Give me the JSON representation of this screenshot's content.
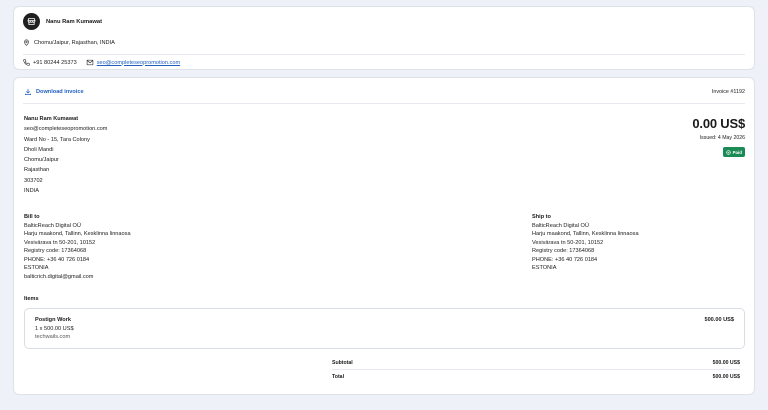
{
  "seller": {
    "name": "Nanu Ram Kumawat",
    "address": "Chomu/Jaipur, Rajasthan, INDIA",
    "phone": "+91 80244 25373",
    "email": "seo@completeseopromotion.com"
  },
  "invoice": {
    "download_label": "Download invoice",
    "number": "Invoice #1192",
    "amount": "0.00 US$",
    "issued": "Issued: 4 May 2026",
    "status": "Paid"
  },
  "from": {
    "name": "Nanu Ram Kumawat",
    "email": "seo@completeseopromotion.com",
    "lines": [
      "Ward No - 15, Tara Colony",
      "Dholi Mandi",
      "Chomu/Jaipur",
      "Rajasthan",
      "303702",
      "INDIA"
    ]
  },
  "bill_to": {
    "title": "Bill to",
    "lines": [
      "BalticReach Digital OÜ",
      "Harju maakond, Tallinn, Kesklinna linnaosa",
      "Vesivärava tn 50-201, 10152",
      "Registry code: 17364068",
      "PHONE: +36 40 726 0184",
      "ESTONIA",
      "balticrich.digital@gmail.com"
    ]
  },
  "ship_to": {
    "title": "Ship to",
    "lines": [
      "BalticReach Digital OÜ",
      "Harju maakond, Tallinn, Kesklinna linnaosa",
      "Vesivärava tn 50-201, 10152",
      "Registry code: 17364068",
      "PHONE: +36 40 726 0184",
      "ESTONIA"
    ]
  },
  "items": {
    "title": "Items",
    "list": [
      {
        "name": "Postign Work",
        "qty": "1 x 500.00 US$",
        "source": "techwails.com",
        "amount": "500.00 US$"
      }
    ]
  },
  "totals": {
    "subtotal_label": "Subtotal",
    "subtotal": "500.00 US$",
    "total_label": "Total",
    "total": "500.00 US$"
  },
  "colors": {
    "accent": "#1f5fbf",
    "paid": "#1c8a55",
    "background": "#eef1f7"
  }
}
